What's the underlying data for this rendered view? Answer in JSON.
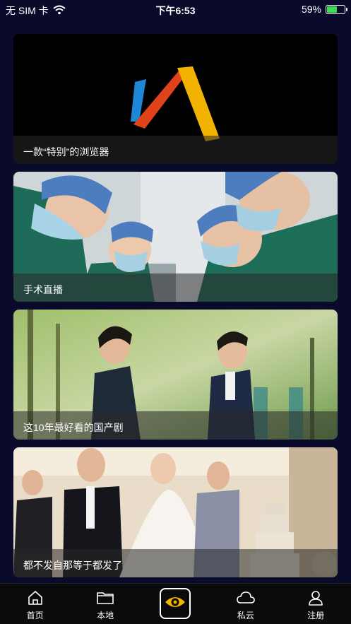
{
  "status_bar": {
    "carrier": "无 SIM 卡",
    "time": "下午6:53",
    "battery_percent": "59%",
    "battery_level": 0.59
  },
  "feed": {
    "items": [
      {
        "title": "一款“特别”的浏览器"
      },
      {
        "title": "手术直播"
      },
      {
        "title": "这10年最好看的国产剧"
      },
      {
        "title": "都不发自那等于都发了"
      }
    ]
  },
  "tab_bar": {
    "home": "首页",
    "local": "本地",
    "cloud": "私云",
    "register": "注册"
  },
  "colors": {
    "background": "#0a0a2a",
    "accent_yellow": "#f5b400"
  }
}
